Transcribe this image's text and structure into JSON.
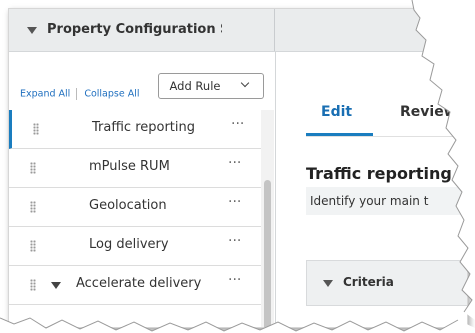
{
  "header": {
    "title": "Property Configuration Setti"
  },
  "toolbar": {
    "expand_all": "Expand All",
    "collapse_all": "Collapse All",
    "add_rule": "Add Rule"
  },
  "rules": [
    {
      "label": "Traffic reporting",
      "more": "···"
    },
    {
      "label": "mPulse RUM",
      "more": "···"
    },
    {
      "label": "Geolocation",
      "more": "···"
    },
    {
      "label": "Log delivery",
      "more": "···"
    },
    {
      "label": "Accelerate delivery",
      "more": "···"
    }
  ],
  "detail": {
    "tabs": {
      "edit": "Edit",
      "review": "Review"
    },
    "title": "Traffic reporting",
    "description": "Identify your main t",
    "criteria": "Criteria"
  },
  "colors": {
    "accent": "#1a7dbf",
    "header_bg": "#eaeced"
  }
}
